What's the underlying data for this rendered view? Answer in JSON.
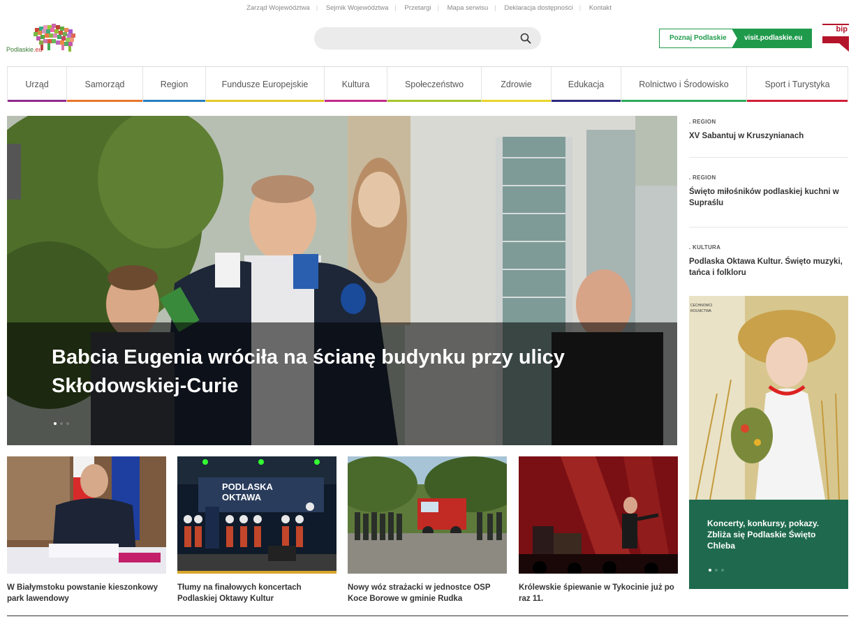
{
  "top_links": [
    "Zarząd Województwa",
    "Sejmik Województwa",
    "Przetargi",
    "Mapa serwisu",
    "Deklaracja dostępności",
    "Kontakt"
  ],
  "logo": {
    "text_main": "Podlaskie",
    "text_suffix": ".eu"
  },
  "search": {
    "placeholder": ""
  },
  "visit": {
    "left_label": "Poznaj Podlaskie",
    "right_label": "visit.podlaskie.eu"
  },
  "bip": {
    "label": "bip"
  },
  "nav": [
    {
      "label": "Urząd",
      "color": "#8e2a91"
    },
    {
      "label": "Samorząd",
      "color": "#e8762c"
    },
    {
      "label": "Region",
      "color": "#2a7fc1"
    },
    {
      "label": "Fundusze Europejskie",
      "color": "#e4c82a"
    },
    {
      "label": "Kultura",
      "color": "#c12a8a"
    },
    {
      "label": "Społeczeństwo",
      "color": "#a6c62e"
    },
    {
      "label": "Zdrowie",
      "color": "#e9d52b"
    },
    {
      "label": "Edukacja",
      "color": "#2d2a7e"
    },
    {
      "label": "Rolnictwo i Środowisko",
      "color": "#2fa95b"
    },
    {
      "label": "Sport i Turystyka",
      "color": "#d11f3a"
    }
  ],
  "hero": {
    "title": "Babcia Eugenia wróciła na ścianę budynku przy ulicy Skłodowskiej-Curie",
    "slides": 3,
    "active": 0
  },
  "side_news": [
    {
      "category": ". REGION",
      "title": "XV Sabantuj w Kruszynianach"
    },
    {
      "category": ". REGION",
      "title": "Święto miłośników podlaskiej kuchni w Supraślu"
    },
    {
      "category": ". KULTURA",
      "title": "Podlaska Oktawa Kultur. Święto muzyki, tańca i folkloru"
    }
  ],
  "promo": {
    "title": "Koncerty, konkursy, pokazy. Zbliża się Podlaskie Święto Chleba",
    "poster_text": "CECHNOWCI\nROLNICTWA",
    "slides": 3,
    "active": 0
  },
  "cards": [
    {
      "title": "W Białymstoku powstanie kieszonkowy park lawendowy"
    },
    {
      "title": "Tłumy na finałowych koncertach Podlaskiej Oktawy Kultur",
      "banner": "PODLASKA OKTAWA"
    },
    {
      "title": "Nowy wóz strażacki w jednostce OSP Koce Borowe w gminie Rudka"
    },
    {
      "title": "Królewskie śpiewanie w Tykocinie już po raz 11."
    }
  ]
}
